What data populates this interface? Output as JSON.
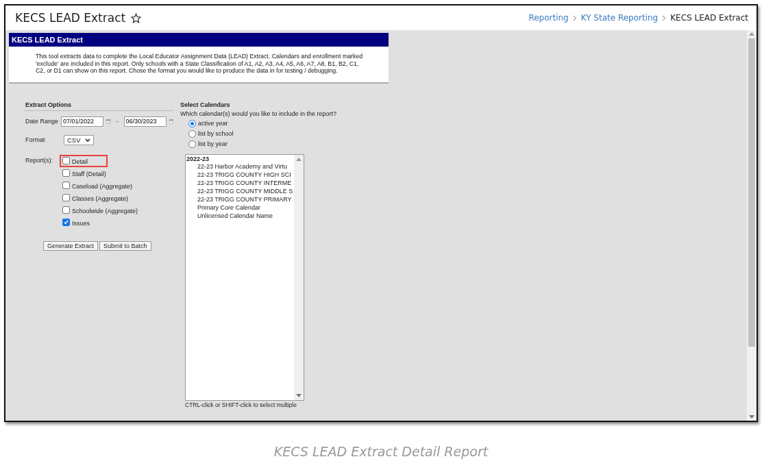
{
  "header": {
    "title": "KECS LEAD Extract",
    "favorite": false,
    "breadcrumbs": [
      {
        "label": "Reporting",
        "kind": "link"
      },
      {
        "label": "KY State Reporting",
        "kind": "link"
      },
      {
        "label": "KECS LEAD Extract",
        "kind": "current"
      }
    ]
  },
  "panel": {
    "title": "KECS LEAD Extract",
    "description": "This tool extracts data to complete the Local Educator Assignment Data (LEAD) Extract. Calendars and enrollment marked 'exclude' are included in this report. Only schools with a State Classification of A1, A2, A3, A4, A5, A6, A7, A8, B1, B2, C1, C2, or D1 can show on this report. Chose the format you would like to produce the data in for testing / debugging."
  },
  "extract_options": {
    "title": "Extract Options",
    "date_range": {
      "label": "Date Range",
      "start": "07/01/2022",
      "separator": "-",
      "end": "06/30/2023"
    },
    "format": {
      "label": "Format",
      "value": "CSV"
    },
    "reports_label": "Report(s):",
    "reports": [
      {
        "label": "Detail",
        "checked": false,
        "highlighted": true
      },
      {
        "label": "Staff (Detail)",
        "checked": false,
        "highlighted": false
      },
      {
        "label": "Caseload (Aggregate)",
        "checked": false,
        "highlighted": false
      },
      {
        "label": "Classes (Aggregate)",
        "checked": false,
        "highlighted": false
      },
      {
        "label": "Schoolwide (Aggregate)",
        "checked": false,
        "highlighted": false
      },
      {
        "label": "Issues",
        "checked": true,
        "highlighted": false
      }
    ],
    "buttons": [
      "Generate Extract",
      "Submit to Batch"
    ]
  },
  "select_calendars": {
    "title": "Select Calendars",
    "question": "Which calendar(s) would you like to include in the report?",
    "options": [
      {
        "label": "active year",
        "selected": true
      },
      {
        "label": "list by school",
        "selected": false
      },
      {
        "label": "list by year",
        "selected": false
      }
    ],
    "calendar_list": {
      "group": "2022-23",
      "items": [
        "22-23 Harbor Academy and Virtu",
        "22-23 TRIGG COUNTY HIGH SCI",
        "22-23 TRIGG COUNTY INTERME",
        "22-23 TRIGG COUNTY MIDDLE S",
        "22-23 TRIGG COUNTY PRIMARY",
        "Primary Core Calendar",
        "Unlicensed Calendar Name"
      ]
    },
    "hint": "CTRL-click or SHIFT-click to select multiple"
  },
  "caption": "KECS LEAD Extract Detail Report"
}
